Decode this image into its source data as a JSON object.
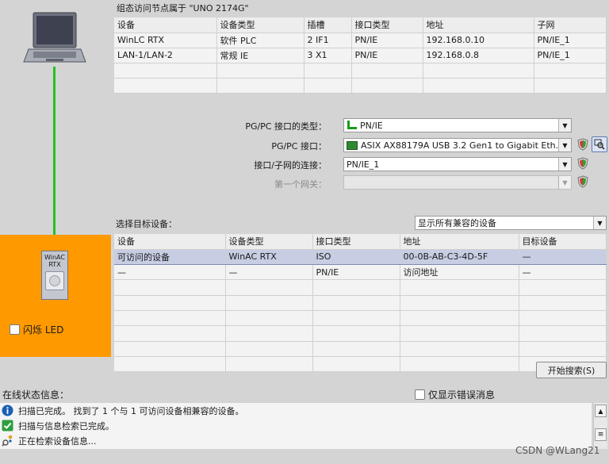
{
  "node_section": {
    "title": "组态访问节点属于 \"UNO 2174G\"",
    "columns": [
      "设备",
      "设备类型",
      "插槽",
      "接口类型",
      "地址",
      "子网"
    ],
    "rows": [
      [
        "WinLC RTX",
        "软件 PLC",
        "2 IF1",
        "PN/IE",
        "192.168.0.10",
        "PN/IE_1"
      ],
      [
        "LAN-1/LAN-2",
        "常规 IE",
        "3 X1",
        "PN/IE",
        "192.168.0.8",
        "PN/IE_1"
      ]
    ]
  },
  "config": {
    "pgpc_type_label": "PG/PC 接口的类型：",
    "pgpc_type_value": "PN/IE",
    "pgpc_interface_label": "PG/PC 接口：",
    "pgpc_interface_value": "ASIX AX88179A USB 3.2 Gen1 to Gigabit Eth...",
    "subnet_conn_label": "接口/子网的连接：",
    "subnet_conn_value": "PN/IE_1",
    "first_gateway_label": "第一个网关：",
    "first_gateway_value": ""
  },
  "target_section": {
    "label": "选择目标设备：",
    "filter_value": "显示所有兼容的设备",
    "columns": [
      "设备",
      "设备类型",
      "接口类型",
      "地址",
      "目标设备"
    ],
    "rows": [
      [
        "可访问的设备",
        "WinAC RTX",
        "ISO",
        "00-0B-AB-C3-4D-5F",
        "—"
      ],
      [
        "—",
        "—",
        "PN/IE",
        "访问地址",
        "—"
      ]
    ],
    "empty_rows": 6
  },
  "left_panel": {
    "device_label_line1": "WinAC",
    "device_label_line2": "RTX",
    "flash_led_label": "闪烁 LED"
  },
  "start_search_label": "开始搜索(S)",
  "status": {
    "header": "在线状态信息：",
    "errors_only_label": "仅显示错误消息",
    "messages": [
      {
        "icon": "info-icon",
        "text": "扫描已完成。 找到了 1 个与 1 可访问设备相兼容的设备。"
      },
      {
        "icon": "check-icon",
        "text": "扫描与信息检索已完成。"
      },
      {
        "icon": "search-progress-icon",
        "text": "正在检索设备信息..."
      }
    ]
  },
  "watermark": "CSDN @WLang21"
}
